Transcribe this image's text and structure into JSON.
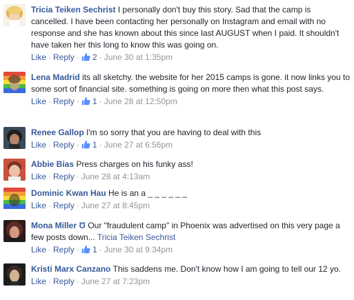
{
  "comments": [
    {
      "author": "Tricia Teiken Sechrist",
      "text": "I personally don't buy this story. Sad that the camp is cancelled. I have been contacting her personally on Instagram and email with no response and she has known about this since last AUGUST when I paid. It shouldn't have taken her this long to know this was going on.",
      "like_label": "Like",
      "reply_label": "Reply",
      "like_count": "2",
      "time": "June 30 at 1:35pm",
      "avatar_colors": [
        "#f3d6a0",
        "#e0b24a",
        "#ffffff"
      ]
    },
    {
      "author": "Lena Madrid",
      "text": "its all sketchy. the website for her 2015 camps is gone. it now links you to some sort of financial site. something is going on more then what this post says.",
      "like_label": "Like",
      "reply_label": "Reply",
      "like_count": "1",
      "time": "June 28 at 12:50pm",
      "avatar_colors": [
        "#e04a3a",
        "#f2c23a",
        "#3a8de0",
        "#8a4ac8"
      ]
    },
    {
      "author": "Renee Gallop",
      "text": "I'm so sorry that you are having to deal with this",
      "like_label": "Like",
      "reply_label": "Reply",
      "like_count": "1",
      "time": "June 27 at 6:56pm",
      "avatar_colors": [
        "#2b2b2b",
        "#b98a6a",
        "#4a6b8a"
      ]
    },
    {
      "author": "Abbie Bias",
      "text": "Press charges on his funky ass!",
      "like_label": "Like",
      "reply_label": "Reply",
      "time": "June 28 at 4:13am",
      "avatar_colors": [
        "#c24a3a",
        "#e8b8a0",
        "#7a3a2a"
      ]
    },
    {
      "author": "Dominic Kwan Hau",
      "text": "He is an a _ _ _ _ _ _",
      "like_label": "Like",
      "reply_label": "Reply",
      "time": "June 27 at 8:45pm",
      "avatar_colors": [
        "#e04a3a",
        "#f2a03a",
        "#f2e03a",
        "#4ab84a",
        "#3a6ae0",
        "#8a3ac8"
      ]
    },
    {
      "author": "Mona Miller",
      "badge": "Ʊ",
      "text": "Our \"fraudulent camp\" in Phoenix was advertised on this very page a few posts down...",
      "mention": "Tricia Teiken Sechrist",
      "like_label": "Like",
      "reply_label": "Reply",
      "like_count": "1",
      "time": "June 30 at 9:34pm",
      "avatar_colors": [
        "#6a2a2a",
        "#c08a70",
        "#3a1a1a"
      ]
    },
    {
      "author": "Kristi Marx Canzano",
      "text": "This saddens me. Don't know how I am going to tell our 12 yo.",
      "like_label": "Like",
      "reply_label": "Reply",
      "time": "June 27 at 7:23pm",
      "avatar_colors": [
        "#1a1a1a",
        "#d0b090",
        "#5a3a2a"
      ]
    }
  ],
  "colors": {
    "link": "#365899",
    "text": "#1d2129",
    "meta": "#90949c"
  },
  "icons": {
    "like": "thumbs-up-icon"
  }
}
